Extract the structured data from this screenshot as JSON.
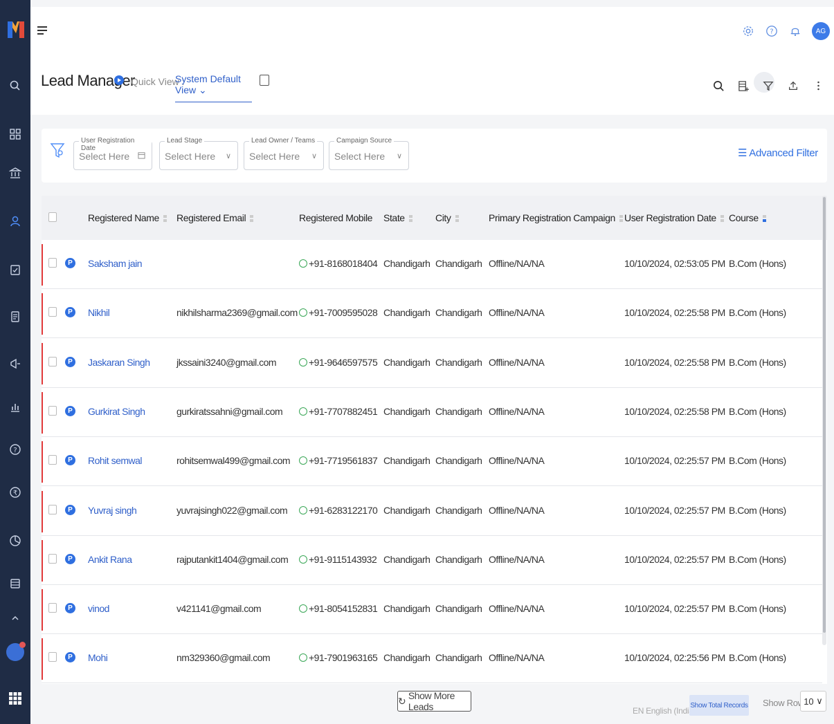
{
  "app": {
    "avatar_initials": "AG"
  },
  "header": {
    "title": "Lead Manager",
    "quick_view_label": "Quick View :",
    "quick_view_value": "System Default View"
  },
  "filters": {
    "fields": [
      {
        "label": "User Registration Date",
        "placeholder": "Select Here"
      },
      {
        "label": "Lead Stage",
        "placeholder": "Select Here"
      },
      {
        "label": "Lead Owner / Teams",
        "placeholder": "Select Here"
      },
      {
        "label": "Campaign Source",
        "placeholder": "Select Here"
      }
    ],
    "advanced": "Advanced Filter"
  },
  "table": {
    "columns": [
      "Registered Name",
      "Registered Email",
      "Registered Mobile",
      "State",
      "City",
      "Primary Registration Campaign",
      "User Registration Date",
      "Course"
    ],
    "badge": "P",
    "rows": [
      {
        "name": "Saksham jain",
        "email": "",
        "mobile": "+91-8168018404",
        "state": "Chandigarh",
        "city": "Chandigarh",
        "campaign": "Offline/NA/NA",
        "date": "10/10/2024, 02:53:05 PM",
        "course": "B.Com (Hons)"
      },
      {
        "name": "Nikhil",
        "email": "nikhilsharma2369@gmail.com",
        "mobile": "+91-7009595028",
        "state": "Chandigarh",
        "city": "Chandigarh",
        "campaign": "Offline/NA/NA",
        "date": "10/10/2024, 02:25:58 PM",
        "course": "B.Com (Hons)"
      },
      {
        "name": "Jaskaran Singh",
        "email": "jkssaini3240@gmail.com",
        "mobile": "+91-9646597575",
        "state": "Chandigarh",
        "city": "Chandigarh",
        "campaign": "Offline/NA/NA",
        "date": "10/10/2024, 02:25:58 PM",
        "course": "B.Com (Hons)"
      },
      {
        "name": "Gurkirat Singh",
        "email": "gurkiratssahni@gmail.com",
        "mobile": "+91-7707882451",
        "state": "Chandigarh",
        "city": "Chandigarh",
        "campaign": "Offline/NA/NA",
        "date": "10/10/2024, 02:25:58 PM",
        "course": "B.Com (Hons)"
      },
      {
        "name": "Rohit semwal",
        "email": "rohitsemwal499@gmail.com",
        "mobile": "+91-7719561837",
        "state": "Chandigarh",
        "city": "Chandigarh",
        "campaign": "Offline/NA/NA",
        "date": "10/10/2024, 02:25:57 PM",
        "course": "B.Com (Hons)"
      },
      {
        "name": "Yuvraj singh",
        "email": "yuvrajsingh022@gmail.com",
        "mobile": "+91-6283122170",
        "state": "Chandigarh",
        "city": "Chandigarh",
        "campaign": "Offline/NA/NA",
        "date": "10/10/2024, 02:25:57 PM",
        "course": "B.Com (Hons)"
      },
      {
        "name": "Ankit Rana",
        "email": "rajputankit1404@gmail.com",
        "mobile": "+91-9115143932",
        "state": "Chandigarh",
        "city": "Chandigarh",
        "campaign": "Offline/NA/NA",
        "date": "10/10/2024, 02:25:57 PM",
        "course": "B.Com (Hons)"
      },
      {
        "name": "vinod",
        "email": "v421141@gmail.com",
        "mobile": "+91-8054152831",
        "state": "Chandigarh",
        "city": "Chandigarh",
        "campaign": "Offline/NA/NA",
        "date": "10/10/2024, 02:25:57 PM",
        "course": "B.Com (Hons)"
      },
      {
        "name": "Mohi",
        "email": "nm329360@gmail.com",
        "mobile": "+91-7901963165",
        "state": "Chandigarh",
        "city": "Chandigarh",
        "campaign": "Offline/NA/NA",
        "date": "10/10/2024, 02:25:56 PM",
        "course": "B.Com (Hons)"
      }
    ]
  },
  "footer": {
    "show_more": "Show More Leads",
    "language": "EN English (India)",
    "show_total": "Show Total Records",
    "show_rows_label": "Show Rows",
    "rows_value": "10"
  },
  "colors": {
    "accent": "#2f6fe0",
    "sidebar": "#1f2c45",
    "row_marker": "#e23a3a"
  }
}
